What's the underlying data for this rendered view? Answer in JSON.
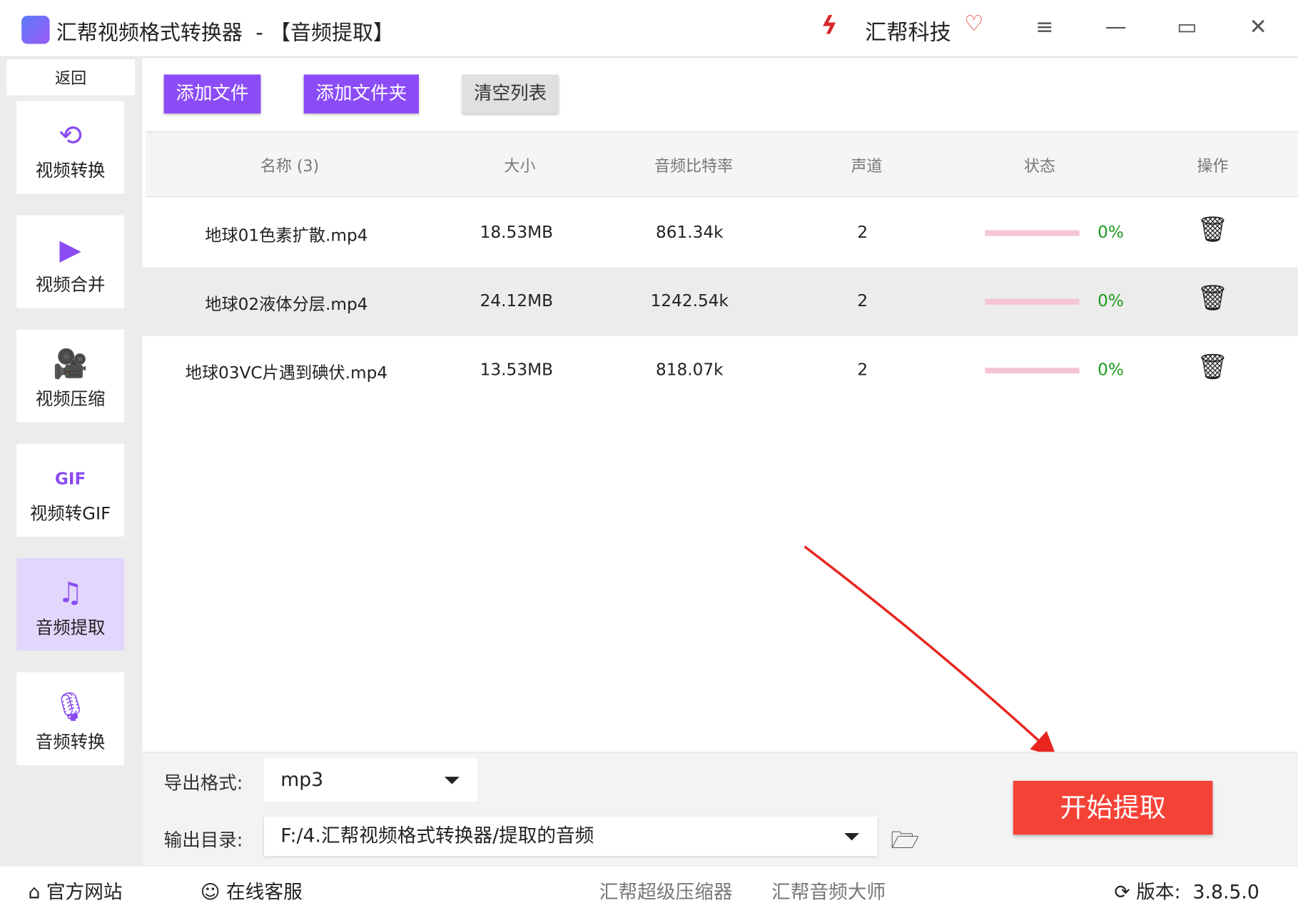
{
  "window": {
    "title": "汇帮视频格式转换器  - 【音频提取】",
    "brand": "汇帮科技",
    "menu_icon": "≡",
    "minimize_icon": "—",
    "maximize_icon": "▭",
    "close_icon": "✕"
  },
  "sidebar": {
    "back": "返回",
    "items": [
      {
        "label": "视频转换",
        "icon": "video-convert-icon",
        "glyph": "⟲"
      },
      {
        "label": "视频合并",
        "icon": "video-merge-icon",
        "glyph": "▶"
      },
      {
        "label": "视频压缩",
        "icon": "video-compress-icon",
        "glyph": "🎥"
      },
      {
        "label": "视频转GIF",
        "icon": "gif-icon",
        "glyph": "GIF"
      },
      {
        "label": "音频提取",
        "icon": "music-note-icon",
        "glyph": "♫",
        "active": true
      },
      {
        "label": "音频转换",
        "icon": "microphone-icon",
        "glyph": "🎙"
      }
    ]
  },
  "toolbar": {
    "add_file": "添加文件",
    "add_folder": "添加文件夹",
    "clear_list": "清空列表"
  },
  "table": {
    "headers": [
      "名称 (3)",
      "大小",
      "音频比特率",
      "声道",
      "状态",
      "操作"
    ],
    "rows": [
      {
        "name": "地球01色素扩散.mp4",
        "size": "18.53MB",
        "bitrate": "861.34k",
        "channels": "2",
        "progress": "0%"
      },
      {
        "name": "地球02液体分层.mp4",
        "size": "24.12MB",
        "bitrate": "1242.54k",
        "channels": "2",
        "progress": "0%"
      },
      {
        "name": "地球03VC片遇到碘伏.mp4",
        "size": "13.53MB",
        "bitrate": "818.07k",
        "channels": "2",
        "progress": "0%"
      }
    ]
  },
  "output": {
    "format_label": "导出格式:",
    "format_value": "mp3",
    "dir_label": "输出目录:",
    "dir_value": "F:/4.汇帮视频格式转换器/提取的音频"
  },
  "start_button": "开始提取",
  "footer": {
    "website": "官方网站",
    "support": "在线客服",
    "compressor": "汇帮超级压缩器",
    "audio_master": "汇帮音频大师",
    "version": "版本:  3.8.5.0"
  },
  "colors": {
    "accent": "#8b4cf7",
    "start": "#f44336",
    "progress": "#f6c5d3",
    "percent": "#1e9c1e"
  }
}
